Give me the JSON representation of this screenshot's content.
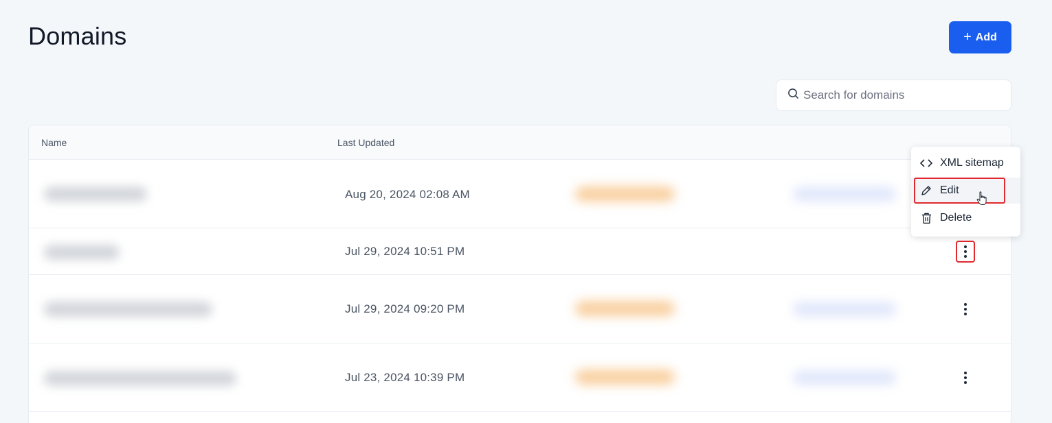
{
  "header": {
    "title": "Domains",
    "add_label": "Add"
  },
  "search": {
    "placeholder": "Search for domains",
    "value": ""
  },
  "table": {
    "columns": [
      "Name",
      "Last Updated"
    ],
    "rows": [
      {
        "last_updated": "Aug 20, 2024 02:08 AM"
      },
      {
        "last_updated": "Jul 29, 2024 10:51 PM"
      },
      {
        "last_updated": "Jul 29, 2024 09:20 PM"
      },
      {
        "last_updated": "Jul 23, 2024 10:39 PM"
      }
    ]
  },
  "row_menu": {
    "items": [
      {
        "label": "XML sitemap",
        "icon": "code-icon"
      },
      {
        "label": "Edit",
        "icon": "pencil-icon"
      },
      {
        "label": "Delete",
        "icon": "trash-icon"
      }
    ],
    "highlighted": "Edit"
  },
  "colors": {
    "accent": "#1a5ef0",
    "highlight": "#e0282e",
    "background": "#f3f7fa"
  }
}
